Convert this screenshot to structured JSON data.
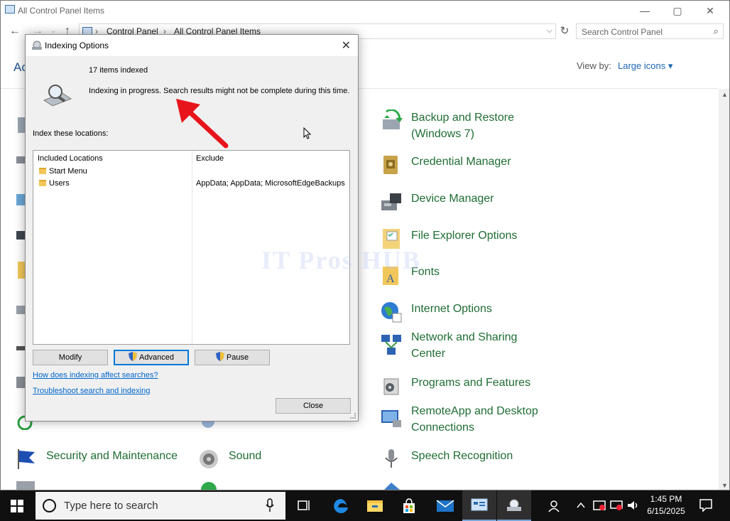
{
  "control_panel": {
    "window_title": "All Control Panel Items",
    "controls": {
      "minimize": "—",
      "maximize": "▢",
      "close": "✕"
    },
    "breadcrumb": [
      "Control Panel",
      "All Control Panel Items"
    ],
    "search_placeholder": "Search Control Panel",
    "header_left": "Ac",
    "view_by_label": "View by:",
    "view_by_value": "Large icons ▾",
    "items": [
      {
        "label": "Backup and Restore\n(Windows 7)",
        "icon": "backup-restore-icon"
      },
      {
        "label": "Credential Manager",
        "icon": "credential-manager-icon"
      },
      {
        "label": "Device Manager",
        "icon": "device-manager-icon"
      },
      {
        "label": "File Explorer Options",
        "icon": "file-explorer-options-icon"
      },
      {
        "label": "Fonts",
        "icon": "fonts-icon"
      },
      {
        "label": "Internet Options",
        "icon": "internet-options-icon"
      },
      {
        "label": "Network and Sharing\nCenter",
        "icon": "network-sharing-icon"
      },
      {
        "label": "Programs and Features",
        "icon": "programs-features-icon"
      },
      {
        "label": "RemoteApp and Desktop\nConnections",
        "icon": "remoteapp-icon"
      },
      {
        "label": "Speech Recognition",
        "icon": "speech-recognition-icon"
      },
      {
        "label": "Security and Maintenance",
        "icon": "security-maintenance-icon"
      },
      {
        "label": "Sound",
        "icon": "sound-icon"
      }
    ]
  },
  "dialog": {
    "title": "Indexing Options",
    "items_indexed": "17 items indexed",
    "status": "Indexing in progress. Search results might not be complete during this time.",
    "locations_label": "Index these locations:",
    "columns": {
      "included": "Included Locations",
      "exclude": "Exclude"
    },
    "rows": [
      {
        "location": "Start Menu",
        "exclude": ""
      },
      {
        "location": "Users",
        "exclude": "AppData; AppData; MicrosoftEdgeBackups"
      }
    ],
    "buttons": {
      "modify": "Modify",
      "advanced": "Advanced",
      "pause": "Pause",
      "close": "Close"
    },
    "links": {
      "how_affect": "How does indexing affect searches?",
      "troubleshoot": "Troubleshoot search and indexing"
    }
  },
  "watermark": "IT Pros HUB",
  "taskbar": {
    "search_placeholder": "Type here to search",
    "time": "1:45 PM",
    "date": "6/15/2025",
    "apps": [
      "task-view-icon",
      "edge-icon",
      "file-explorer-icon",
      "store-icon",
      "mail-icon",
      "control-panel-icon",
      "indexing-options-icon"
    ]
  },
  "colors": {
    "link_green": "#1f6d34",
    "link_blue": "#0066cc",
    "accent": "#0078d7",
    "annotation_arrow": "#e8141b",
    "taskbar": "#101010"
  }
}
